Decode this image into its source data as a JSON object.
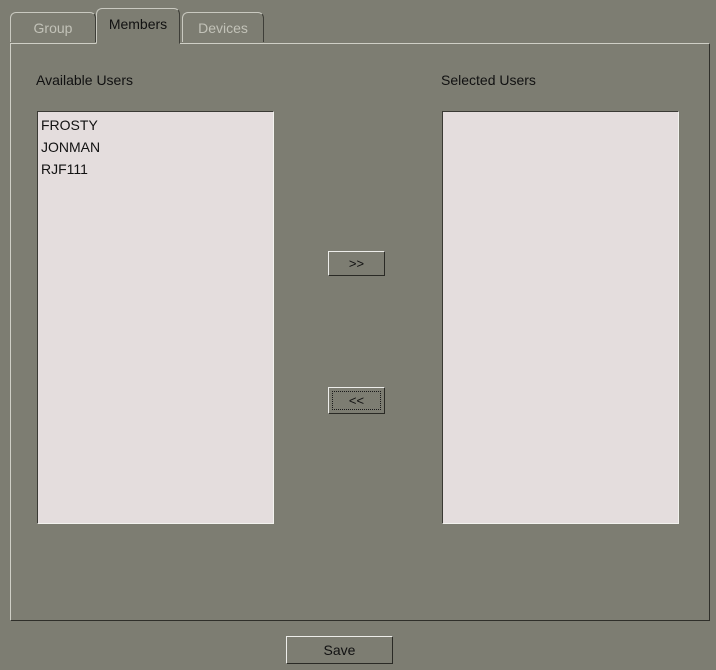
{
  "tabs": [
    {
      "label": "Group",
      "active": false
    },
    {
      "label": "Members",
      "active": true
    },
    {
      "label": "Devices",
      "active": false
    }
  ],
  "available": {
    "label": "Available Users",
    "items": [
      "FROSTY",
      "JONMAN",
      "RJF111"
    ]
  },
  "selected": {
    "label": "Selected Users",
    "items": []
  },
  "buttons": {
    "add_label": ">>",
    "remove_label": "<<",
    "save_label": "Save"
  },
  "colors": {
    "background": "#7d7d72",
    "listbox": "#e4dddd"
  }
}
